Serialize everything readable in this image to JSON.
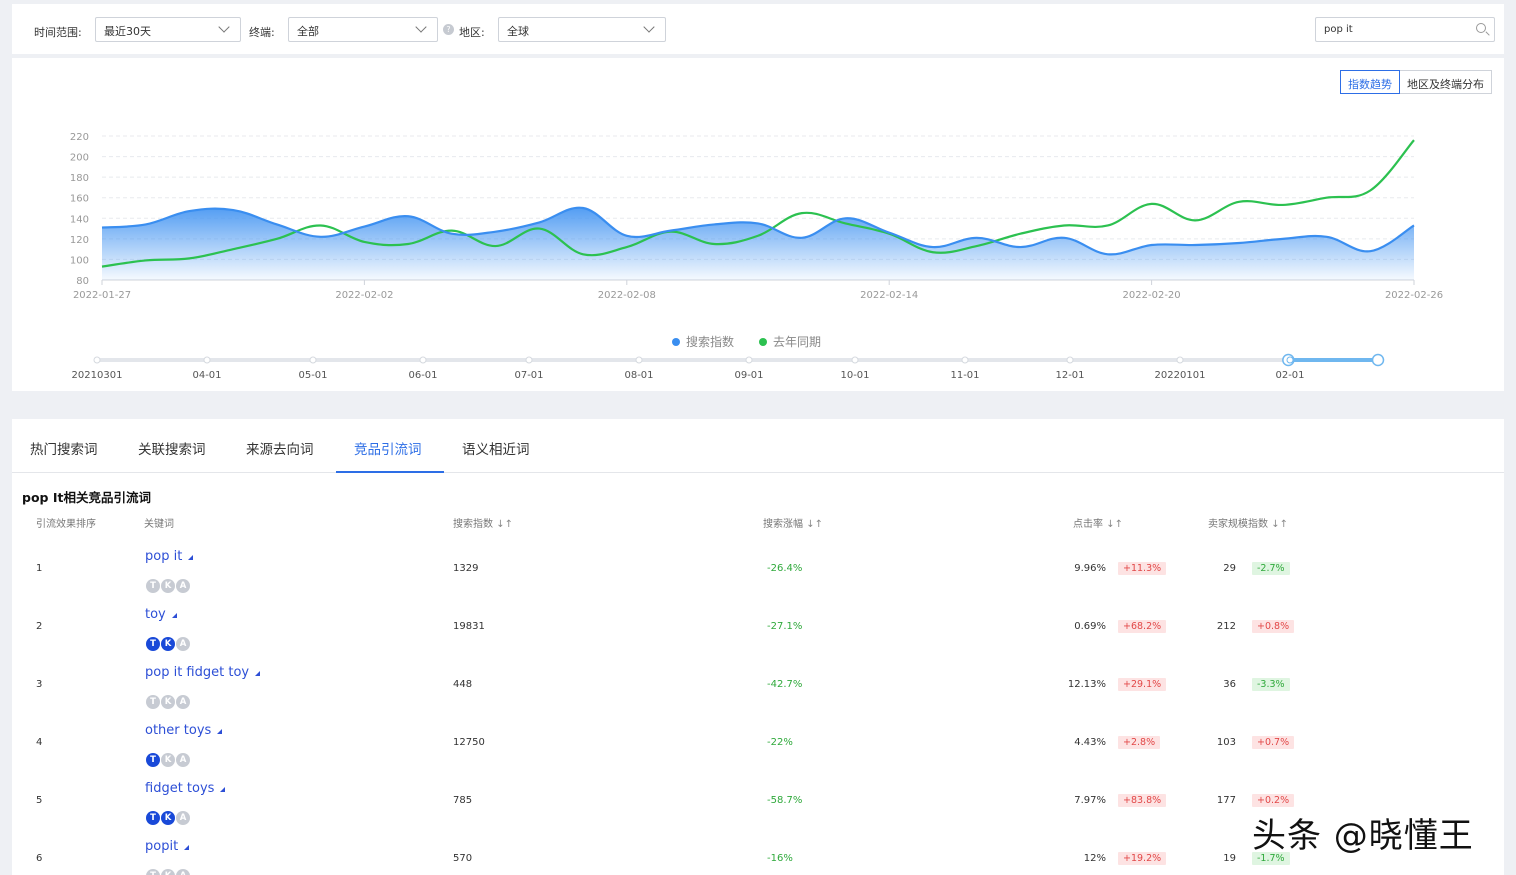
{
  "filters": {
    "time_label": "时间范围:",
    "time_value": "最近30天",
    "device_label": "终端:",
    "device_value": "全部",
    "help_icon_text": "?",
    "region_label": "地区:",
    "region_value": "全球",
    "search_value": "pop it"
  },
  "view_toggle": {
    "trend_label": "指数趋势",
    "region_label": "地区及终端分布"
  },
  "chart_data": {
    "type": "area",
    "x": [
      "2022-01-27",
      "2022-01-28",
      "2022-01-29",
      "2022-01-30",
      "2022-01-31",
      "2022-02-01",
      "2022-02-02",
      "2022-02-03",
      "2022-02-04",
      "2022-02-05",
      "2022-02-06",
      "2022-02-07",
      "2022-02-08",
      "2022-02-09",
      "2022-02-10",
      "2022-02-11",
      "2022-02-12",
      "2022-02-13",
      "2022-02-14",
      "2022-02-15",
      "2022-02-16",
      "2022-02-17",
      "2022-02-18",
      "2022-02-19",
      "2022-02-20",
      "2022-02-21",
      "2022-02-22",
      "2022-02-23",
      "2022-02-24",
      "2022-02-25",
      "2022-02-26"
    ],
    "xticks": [
      "2022-01-27",
      "2022-02-02",
      "2022-02-08",
      "2022-02-14",
      "2022-02-20",
      "2022-02-26"
    ],
    "yticks": [
      80,
      100,
      120,
      140,
      160,
      180,
      200,
      220
    ],
    "ylim": [
      80,
      220
    ],
    "series": [
      {
        "name": "搜索指数",
        "color": "#3a8ef0",
        "values": [
          131,
          134,
          147,
          148,
          134,
          122,
          132,
          142,
          125,
          127,
          136,
          150,
          123,
          128,
          134,
          135,
          121,
          140,
          126,
          112,
          121,
          112,
          121,
          105,
          114,
          114,
          116,
          120,
          122,
          108,
          133
        ]
      },
      {
        "name": "去年同期",
        "color": "#2cc150",
        "values": [
          93,
          99,
          101,
          110,
          120,
          133,
          117,
          115,
          128,
          113,
          130,
          105,
          112,
          127,
          115,
          123,
          145,
          135,
          125,
          107,
          113,
          125,
          133,
          133,
          154,
          138,
          156,
          153,
          160,
          167,
          216
        ]
      }
    ],
    "legend": "bottom-center",
    "grid": true
  },
  "range_slider": {
    "labels": [
      "20210301",
      "04-01",
      "05-01",
      "06-01",
      "07-01",
      "08-01",
      "09-01",
      "10-01",
      "11-01",
      "12-01",
      "20220101",
      "02-01"
    ],
    "selected_start": 0.93,
    "selected_end": 1.0
  },
  "tabs": [
    {
      "label": "热门搜索词"
    },
    {
      "label": "关联搜索词"
    },
    {
      "label": "来源去向词"
    },
    {
      "label": "竞品引流词"
    },
    {
      "label": "语义相近词"
    }
  ],
  "section_title": "pop It相关竞品引流词",
  "columns": {
    "rank": "引流效果排序",
    "keyword": "关键词",
    "search_index": "搜索指数",
    "search_change": "搜索涨幅",
    "ctr": "点击率",
    "seller_index": "卖家规模指数"
  },
  "sort_icon": "↓↑",
  "badge_letters": [
    "T",
    "K",
    "A"
  ],
  "rows": [
    {
      "rank": "1",
      "keyword": "pop it",
      "badges": [
        false,
        false,
        false
      ],
      "search_index": "1329",
      "search_change": "-26.4%",
      "ctr": "9.96%",
      "ctr_change": "+11.3%",
      "seller_index": "29",
      "seller_change": "-2.7%"
    },
    {
      "rank": "2",
      "keyword": "toy",
      "badges": [
        true,
        true,
        false
      ],
      "search_index": "19831",
      "search_change": "-27.1%",
      "ctr": "0.69%",
      "ctr_change": "+68.2%",
      "seller_index": "212",
      "seller_change": "+0.8%"
    },
    {
      "rank": "3",
      "keyword": "pop it fidget toy",
      "badges": [
        false,
        false,
        false
      ],
      "search_index": "448",
      "search_change": "-42.7%",
      "ctr": "12.13%",
      "ctr_change": "+29.1%",
      "seller_index": "36",
      "seller_change": "-3.3%"
    },
    {
      "rank": "4",
      "keyword": "other toys",
      "badges": [
        true,
        false,
        false
      ],
      "search_index": "12750",
      "search_change": "-22%",
      "ctr": "4.43%",
      "ctr_change": "+2.8%",
      "seller_index": "103",
      "seller_change": "+0.7%"
    },
    {
      "rank": "5",
      "keyword": "fidget toys",
      "badges": [
        true,
        true,
        false
      ],
      "search_index": "785",
      "search_change": "-58.7%",
      "ctr": "7.97%",
      "ctr_change": "+83.8%",
      "seller_index": "177",
      "seller_change": "+0.2%"
    },
    {
      "rank": "6",
      "keyword": "popit",
      "badges": [
        false,
        false,
        false
      ],
      "search_index": "570",
      "search_change": "-16%",
      "ctr": "12%",
      "ctr_change": "+19.2%",
      "seller_index": "19",
      "seller_change": "-1.7%"
    }
  ],
  "watermark": "头条 @晓懂王",
  "colors": {
    "accent": "#2d6ee6",
    "up": "#e24848",
    "down": "#2fa93b"
  }
}
